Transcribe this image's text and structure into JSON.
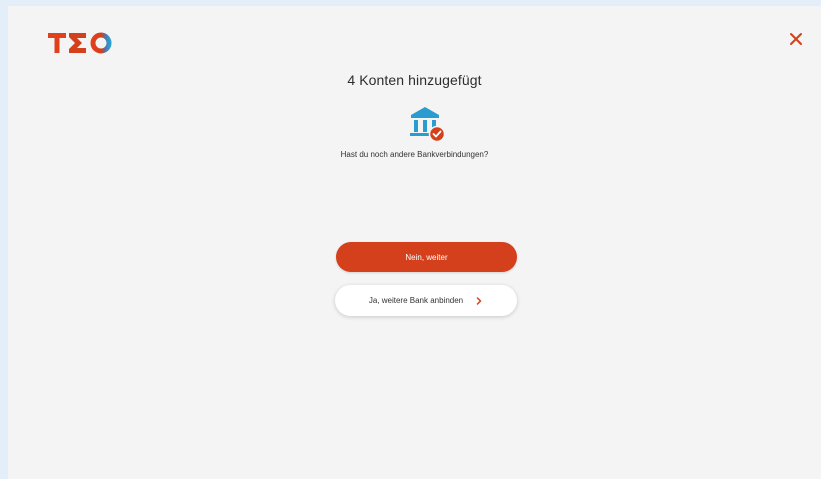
{
  "brand": {
    "logo_text": "TΣO",
    "colors": {
      "red": "#d4401c",
      "blue": "#2a9ccf"
    }
  },
  "header": {
    "close_icon": "close-icon"
  },
  "main": {
    "title": "4 Konten hinzugefügt",
    "icon": "bank-check-icon",
    "question": "Hast du noch andere  Bankverbindungen?",
    "primary_button_label": "Nein, weiter",
    "secondary_button_label": "Ja, weitere Bank anbinden",
    "secondary_button_icon": "chevron-right-icon"
  }
}
